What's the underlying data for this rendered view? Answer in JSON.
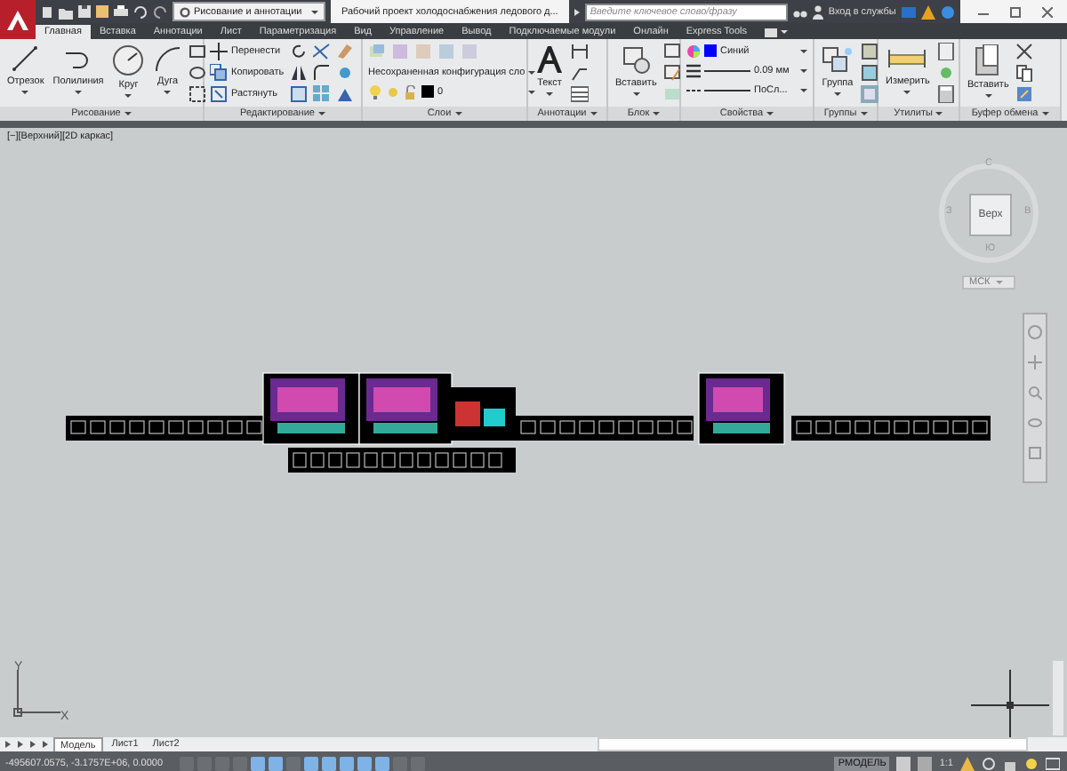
{
  "title_bar": {
    "workspace": "Рисование и аннотации",
    "document_title": "Рабочий проект холодоснабжения ледового д...",
    "search": {
      "placeholder": "Введите ключевое слово/фразу"
    },
    "sign_in": "Вход в службы"
  },
  "tabs": [
    {
      "label": "Главная",
      "selected": true
    },
    {
      "label": "Вставка",
      "selected": false
    },
    {
      "label": "Аннотации",
      "selected": false
    },
    {
      "label": "Лист",
      "selected": false
    },
    {
      "label": "Параметризация",
      "selected": false
    },
    {
      "label": "Вид",
      "selected": false
    },
    {
      "label": "Управление",
      "selected": false
    },
    {
      "label": "Вывод",
      "selected": false
    },
    {
      "label": "Подключаемые модули",
      "selected": false
    },
    {
      "label": "Онлайн",
      "selected": false
    },
    {
      "label": "Express Tools",
      "selected": false
    }
  ],
  "panels": [
    {
      "kind": "draw",
      "title": "Рисование",
      "tools": [
        "Отрезок",
        "Полилиния",
        "Круг",
        "Дуга"
      ]
    },
    {
      "kind": "modify",
      "title": "Редактирование",
      "tools": [
        "Перенести",
        "Копировать",
        "Растянуть"
      ]
    },
    {
      "kind": "layers",
      "title": "Слои",
      "layer_state": "Несохраненная конфигурация сло",
      "current_layer": "0"
    },
    {
      "kind": "annotation",
      "title": "Аннотации",
      "tools": [
        "Текст"
      ]
    },
    {
      "kind": "block",
      "title": "Блок",
      "tools": [
        "Вставить"
      ]
    },
    {
      "kind": "properties",
      "title": "Свойства",
      "color_name": "Синий",
      "lineweight": "0.09 мм",
      "linetype": "ПоСл..."
    },
    {
      "kind": "groups",
      "title": "Группы",
      "tools": [
        "Группа"
      ]
    },
    {
      "kind": "utilities",
      "title": "Утилиты",
      "tools": [
        "Измерить"
      ]
    },
    {
      "kind": "clipboard",
      "title": "Буфер обмена",
      "tools": [
        "Вставить"
      ]
    }
  ],
  "viewport": {
    "label": "[−][Верхний][2D каркас]",
    "viewcube": {
      "face": "Верх",
      "north": "С",
      "east": "В",
      "south": "Ю",
      "west": "З"
    },
    "wcs": "МСК",
    "ucs_x": "X",
    "ucs_y": "Y"
  },
  "layout_tabs": [
    {
      "label": "Модель",
      "selected": true
    },
    {
      "label": "Лист1",
      "selected": false
    },
    {
      "label": "Лист2",
      "selected": false
    }
  ],
  "status_bar": {
    "coordinates": "-495607.0575, -3.1757E+06, 0.0000",
    "toggles": [
      {
        "on": false
      },
      {
        "on": false
      },
      {
        "on": false
      },
      {
        "on": false
      },
      {
        "on": true
      },
      {
        "on": true
      },
      {
        "on": false
      },
      {
        "on": true
      },
      {
        "on": true
      },
      {
        "on": true
      },
      {
        "on": true
      },
      {
        "on": true
      },
      {
        "on": false
      },
      {
        "on": false
      }
    ],
    "space": "РМОДЕЛЬ",
    "annotation_scale": "1:1"
  }
}
